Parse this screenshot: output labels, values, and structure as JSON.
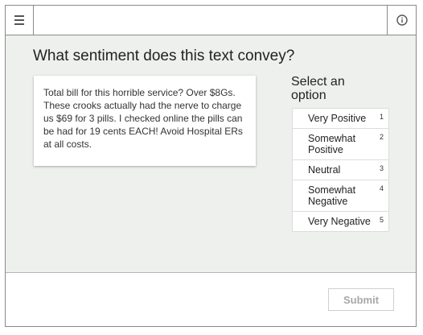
{
  "header": {
    "menu_icon": "hamburger-menu-icon",
    "info_icon": "info-icon"
  },
  "task": {
    "question": "What sentiment does this text convey?",
    "text": "Total bill for this horrible service? Over $8Gs. These crooks actually had the nerve to charge us $69 for 3 pills. I checked online the pills can be had for 19 cents EACH! Avoid Hospital ERs at all costs."
  },
  "options_panel": {
    "title": "Select an option",
    "options": [
      {
        "label": "Very Positive",
        "key": "1"
      },
      {
        "label": "Somewhat Positive",
        "key": "2"
      },
      {
        "label": "Neutral",
        "key": "3"
      },
      {
        "label": "Somewhat Negative",
        "key": "4"
      },
      {
        "label": "Very Negative",
        "key": "5"
      }
    ]
  },
  "footer": {
    "submit_label": "Submit"
  }
}
